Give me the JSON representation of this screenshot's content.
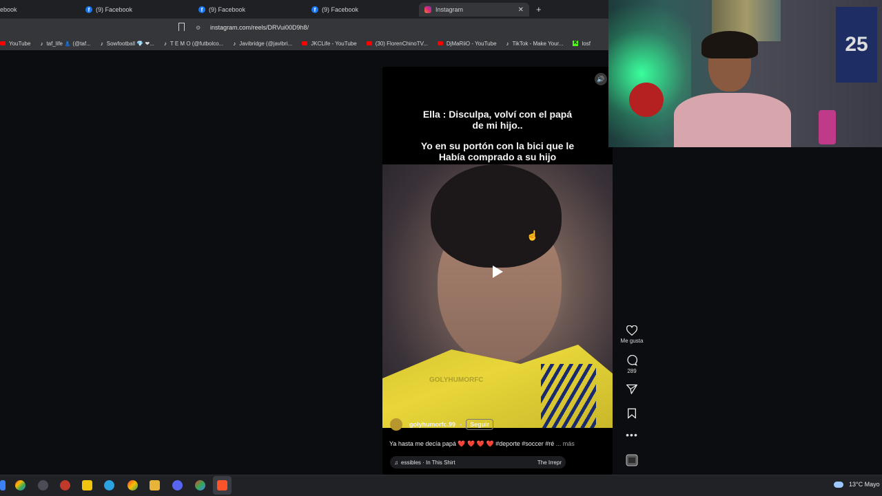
{
  "browser": {
    "tabs": [
      {
        "label": "ebook",
        "icon": "facebook-icon"
      },
      {
        "label": "(9) Facebook",
        "icon": "facebook-icon"
      },
      {
        "label": "(9) Facebook",
        "icon": "facebook-icon"
      },
      {
        "label": "(9) Facebook",
        "icon": "facebook-icon"
      },
      {
        "label": "Instagram",
        "icon": "instagram-icon",
        "active": true
      }
    ],
    "url": "instagram.com/reels/DRVui00D9h8/",
    "bookmarks": [
      {
        "label": "YouTube",
        "icon": "youtube-icon"
      },
      {
        "label": "taf_life 👗 (@taf...",
        "icon": "tiktok-icon"
      },
      {
        "label": "Sowfootball 💎 ❤...",
        "icon": "tiktok-icon"
      },
      {
        "label": "T E M O (@futbolco...",
        "icon": "tiktok-icon"
      },
      {
        "label": "Javibridge (@javibri...",
        "icon": "tiktok-icon"
      },
      {
        "label": "JKCLife - YouTube",
        "icon": "youtube-icon"
      },
      {
        "label": "(30) FlorenChinoTV...",
        "icon": "youtube-icon"
      },
      {
        "label": "DjMaRiiO - YouTube",
        "icon": "youtube-icon"
      },
      {
        "label": "TikTok - Make Your...",
        "icon": "tiktok-icon"
      },
      {
        "label": "losf",
        "icon": "kick-icon"
      }
    ]
  },
  "reel": {
    "caption_lines": [
      "Ella : Disculpa, volví con el papá",
      "de mi hijo..",
      "Yo en su portón con la bici que le",
      "Había comprado a su hijo"
    ],
    "watermark": "GOLYHUMORFC",
    "username": "golyhumorfc.99",
    "follow_label": "Seguir",
    "description": "Ya hasta me decía papá ❤️ ❤️ ❤️ ❤️ #deporte #soccer #ré",
    "more_label": "... más",
    "audio_left": "essibles · In This Shirt",
    "audio_right": "The Irrepr"
  },
  "actions": {
    "like_label": "Me gusta",
    "comments_count": "289"
  },
  "webcam": {
    "jersey_number": "25"
  },
  "tray": {
    "weather": "13°C  Mayo"
  },
  "colors": {
    "tab_bg": "#1f2023",
    "toolbar_bg": "#35363a",
    "page_bg": "#0c0d10",
    "facebook": "#1877f2",
    "youtube": "#ff0000"
  }
}
